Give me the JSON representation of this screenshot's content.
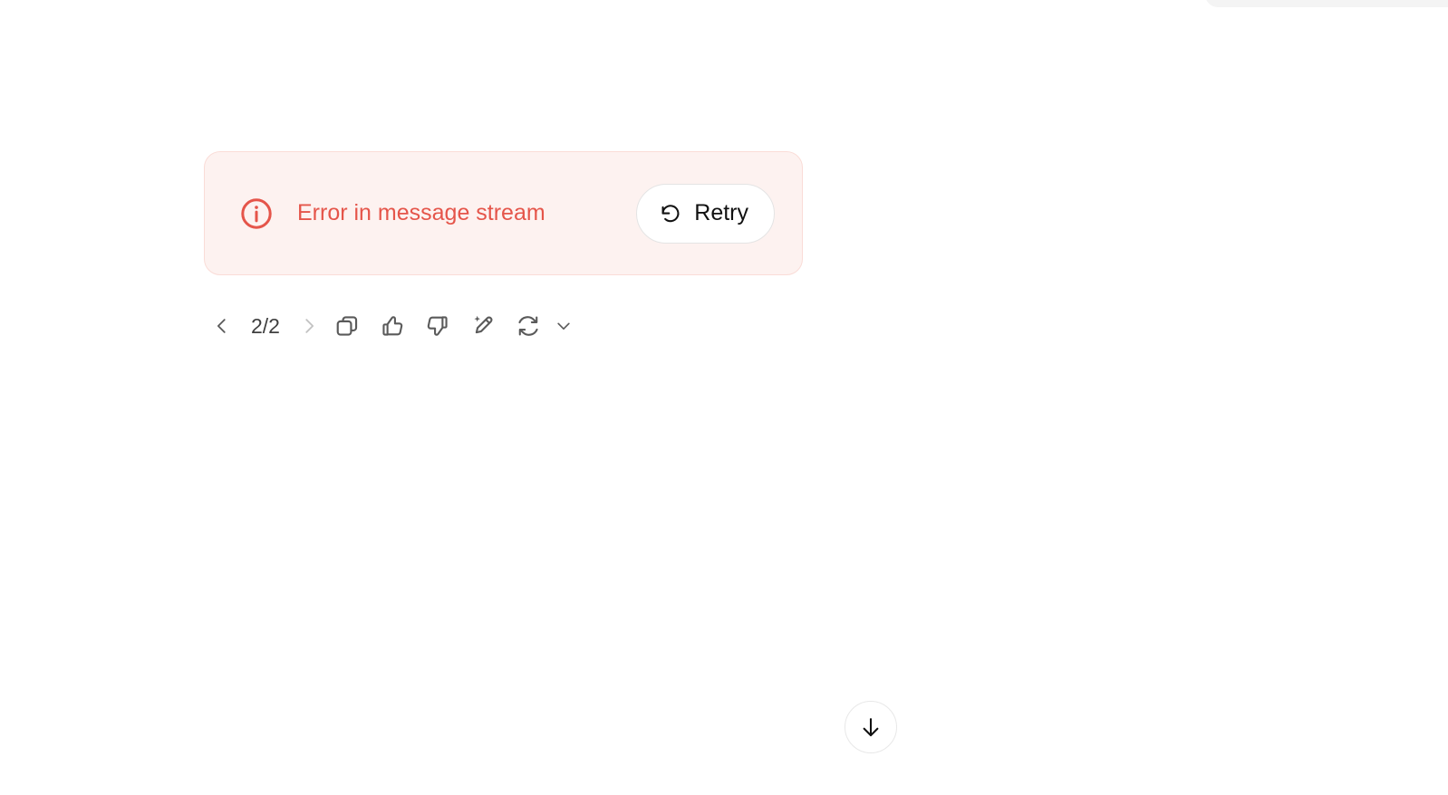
{
  "colors": {
    "page_background": "#ffffff",
    "error_background": "#fdf2f0",
    "error_border": "#fadcd7",
    "error_accent": "#e5554a",
    "icon_gray": "#5a5a5a",
    "icon_gray_disabled": "#c2c2c2",
    "text_dark": "#111111"
  },
  "error_banner": {
    "icon": "info-circle-icon",
    "message": "Error in message stream",
    "retry": {
      "icon": "rotate-ccw-icon",
      "label": "Retry"
    }
  },
  "action_toolbar": {
    "previous": {
      "icon": "chevron-left-icon",
      "enabled": true
    },
    "page_indicator": "2/2",
    "next": {
      "icon": "chevron-right-icon",
      "enabled": false
    },
    "buttons": [
      {
        "name": "copy-button",
        "icon": "copy-icon"
      },
      {
        "name": "thumbs-up-button",
        "icon": "thumbs-up-icon"
      },
      {
        "name": "thumbs-down-button",
        "icon": "thumbs-down-icon"
      },
      {
        "name": "edit-button",
        "icon": "sparkle-pencil-icon"
      }
    ],
    "regenerate": {
      "icon": "refresh-cycle-icon",
      "caret_icon": "chevron-down-icon"
    }
  },
  "scroll_to_bottom": {
    "icon": "arrow-down-icon"
  }
}
